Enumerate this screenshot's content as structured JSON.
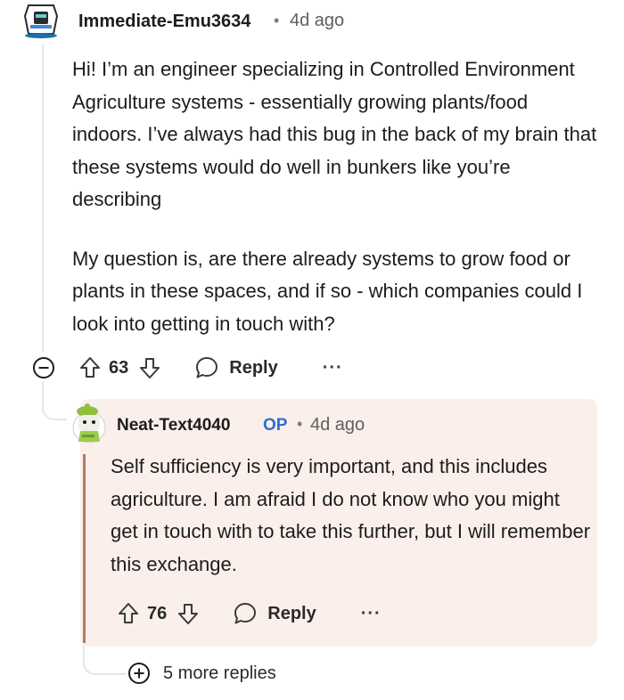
{
  "comment": {
    "author": "Immediate-Emu3634",
    "separator": "•",
    "time": "4d ago",
    "paragraphs": [
      "Hi! I’m an engineer specializing in Controlled Environment Agriculture systems - essentially growing plants/food indoors. I’ve always had this bug in the back of my brain that these systems would do well in bunkers like you’re describing",
      "My question is, are there already systems to grow food or plants in these spaces, and if so - which companies could I look into getting in touch with?"
    ],
    "score": "63",
    "reply_label": "Reply",
    "more_label": "···"
  },
  "reply": {
    "author": "Neat-Text4040",
    "badge": "OP",
    "separator": "•",
    "time": "4d ago",
    "text": "Self sufficiency is very important, and this includes agriculture. I am afraid I do not know who you might get in touch with to take this further, but I will remember this exchange.",
    "score": "76",
    "reply_label": "Reply",
    "more_label": "···",
    "background_color": "#fbefeb",
    "accent_color": "#b6795f"
  },
  "more_replies": {
    "label": "5 more replies"
  },
  "colors": {
    "op_badge": "#2f6fd0",
    "text": "#1c1c1c",
    "meta": "#5e5e5e"
  }
}
